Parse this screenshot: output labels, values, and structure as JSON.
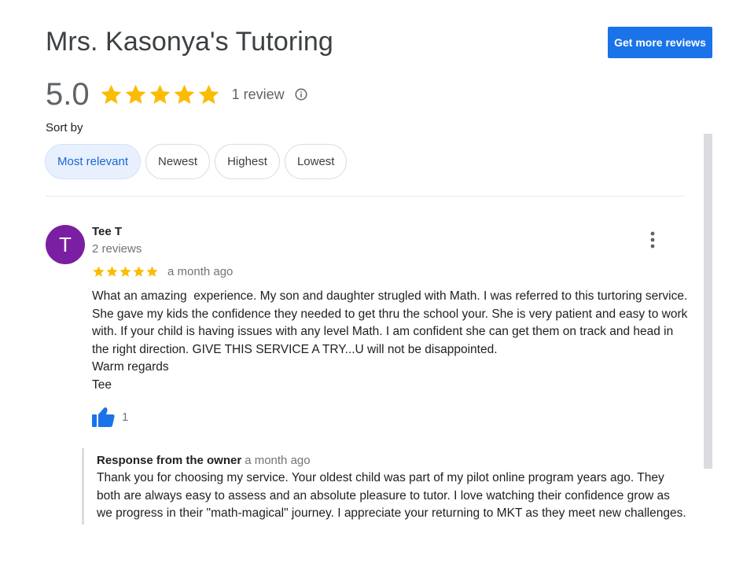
{
  "business": {
    "name": "Mrs. Kasonya's Tutoring",
    "get_reviews_label": "Get more reviews",
    "rating": "5.0",
    "star_count": 5,
    "review_count_label": "1 review",
    "info_icon": "info-icon",
    "star_color": "#fbbc04"
  },
  "sort": {
    "label": "Sort by",
    "options": [
      "Most relevant",
      "Newest",
      "Highest",
      "Lowest"
    ],
    "selected": "Most relevant"
  },
  "review": {
    "avatar_letter": "T",
    "avatar_color": "#7b1fa2",
    "reviewer_name": "Tee T",
    "reviewer_meta": "2 reviews",
    "stars": 5,
    "date": "a month ago",
    "text": "What an amazing  experience. My son and daughter strugled with Math. I was referred to this turtoring service.  She gave my kids the confidence they needed to get thru the school your. She is very patient and easy to work with. If your child is having issues with any level Math. I am confident she can get them on track and head in the right direction. GIVE THIS SERVICE A TRY...U will not be disappointed.\nWarm regards\nTee",
    "like_count": "1",
    "more_icon": "more-vert-icon",
    "like_icon": "thumbs-up-icon"
  },
  "owner_response": {
    "title": "Response from the owner",
    "date": "a month ago",
    "text": "Thank you for choosing my service. Your oldest child was part of my pilot online program years ago. They both are always easy to assess and an absolute pleasure to tutor. I love watching their confidence grow as we progress in their \"math-magical\" journey. I appreciate your returning to MKT as they meet new challenges."
  }
}
